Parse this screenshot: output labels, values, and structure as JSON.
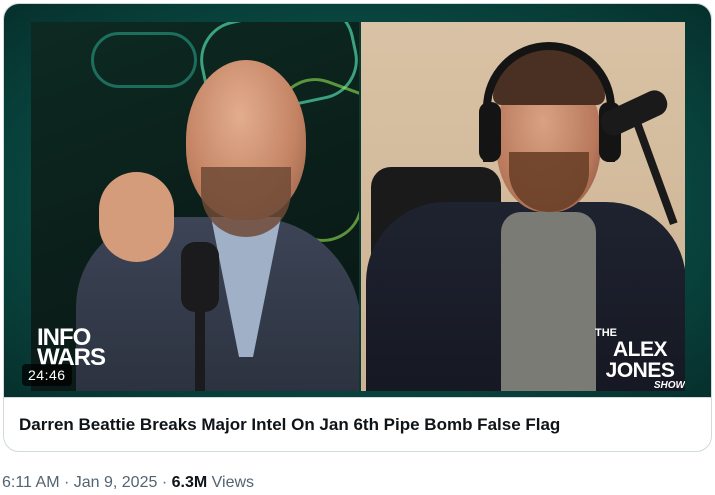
{
  "video": {
    "duration": "24:46",
    "title": "Darren Beattie Breaks Major Intel On Jan 6th Pipe Bomb False Flag",
    "left_logo": "INFO WARS",
    "right_logo": {
      "line1": "THE",
      "line2": "ALEX JONES",
      "line3": "SHOW"
    }
  },
  "meta": {
    "time": "6:11 AM",
    "separator": "·",
    "date": "Jan 9, 2025",
    "views_count": "6.3M",
    "views_label": "Views"
  }
}
